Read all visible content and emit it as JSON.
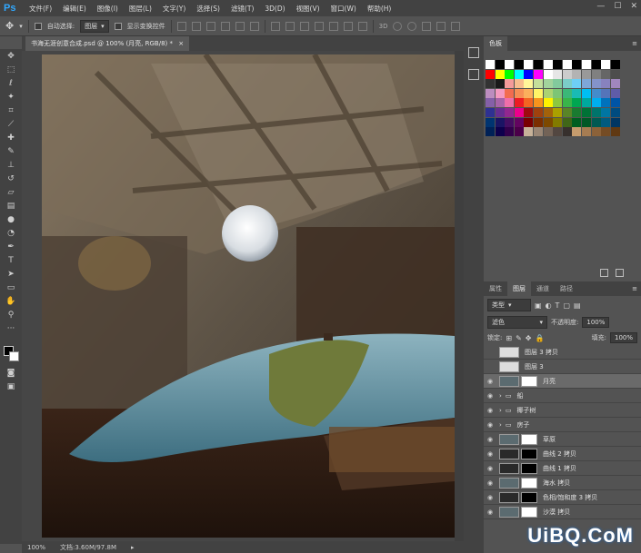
{
  "app": {
    "logo": "Ps"
  },
  "menu": [
    "文件(F)",
    "编辑(E)",
    "图像(I)",
    "图层(L)",
    "文字(Y)",
    "选择(S)",
    "滤镜(T)",
    "3D(D)",
    "视图(V)",
    "窗口(W)",
    "帮助(H)"
  ],
  "options": {
    "auto_select_label": "自动选择:",
    "auto_select_value": "图层",
    "show_transform_label": "显示变换控件"
  },
  "document": {
    "tab_title": "书海无涯创意合成.psd @ 100% (月亮, RGB/8) *"
  },
  "status": {
    "zoom": "100%",
    "doc_size": "文档:3.60M/97.8M"
  },
  "panels": {
    "swatches_tab": "色板",
    "layers_tabs": [
      "属性",
      "图层",
      "通道",
      "路径"
    ],
    "filter_kind": "类型",
    "blend_mode": "滤色",
    "opacity_label": "不透明度:",
    "opacity_value": "100%",
    "lock_label": "锁定:",
    "fill_label": "填充:",
    "fill_value": "100%"
  },
  "layers": [
    {
      "name": "图层 3 拷贝",
      "type": "layer",
      "visible": false
    },
    {
      "name": "图层 3",
      "type": "layer",
      "visible": false
    },
    {
      "name": "月亮",
      "type": "layer-mask",
      "visible": true,
      "selected": true
    },
    {
      "name": "船",
      "type": "group",
      "visible": true
    },
    {
      "name": "椰子树",
      "type": "group",
      "visible": true
    },
    {
      "name": "房子",
      "type": "group",
      "visible": true
    },
    {
      "name": "草原",
      "type": "layer-mask",
      "visible": true
    },
    {
      "name": "曲线 2 拷贝",
      "type": "adjustment",
      "visible": true
    },
    {
      "name": "曲线 1 拷贝",
      "type": "adjustment",
      "visible": true
    },
    {
      "name": "海水 拷贝",
      "type": "layer-mask",
      "visible": true
    },
    {
      "name": "色相/饱和度 3 拷贝",
      "type": "adjustment",
      "visible": true
    },
    {
      "name": "沙漠 拷贝",
      "type": "layer-mask",
      "visible": true
    }
  ],
  "colors": {
    "ps_blue": "#31a8ff",
    "panel": "#535353",
    "dark": "#424242",
    "selected_layer": "#6a6a6a"
  },
  "swatch_colors": [
    "#ffffff",
    "#000000",
    "#ffffff",
    "#000000",
    "#ffffff",
    "#000000",
    "#ffffff",
    "#000000",
    "#ffffff",
    "#000000",
    "#ffffff",
    "#000000",
    "#ffffff",
    "#000000",
    "#ff0000",
    "#ffff00",
    "#00ff00",
    "#00ffff",
    "#0000ff",
    "#ff00ff",
    "#ffffff",
    "#e6e6e6",
    "#cccccc",
    "#b3b3b3",
    "#999999",
    "#808080",
    "#666666",
    "#4d4d4d",
    "#333333",
    "#1a1a1a",
    "#f49a9a",
    "#f7bd8e",
    "#fff799",
    "#c4df9b",
    "#a2d39c",
    "#82ca9d",
    "#7bcdc8",
    "#6ecff6",
    "#7ea7d8",
    "#8493ca",
    "#8882be",
    "#a187be",
    "#bc8dbf",
    "#f49ac1",
    "#f26c4f",
    "#f68e55",
    "#fbaf5c",
    "#fff467",
    "#acd372",
    "#7cc576",
    "#3bb878",
    "#1abbb4",
    "#00bff3",
    "#448ccb",
    "#5574b9",
    "#605ca8",
    "#8560a8",
    "#a864a8",
    "#f06ea9",
    "#ed1c24",
    "#f26522",
    "#f7941d",
    "#fff200",
    "#8dc73f",
    "#39b54a",
    "#00a651",
    "#00a99d",
    "#00aeef",
    "#0072bc",
    "#0054a6",
    "#2e3192",
    "#662d91",
    "#92278f",
    "#ec008c",
    "#9e0b0f",
    "#a0410d",
    "#a3620a",
    "#aba000",
    "#598527",
    "#1a7b30",
    "#007236",
    "#00746b",
    "#0076a3",
    "#004b80",
    "#003471",
    "#1b1464",
    "#440e62",
    "#630460",
    "#790000",
    "#7b2e00",
    "#7d4900",
    "#827b00",
    "#406618",
    "#005e20",
    "#005826",
    "#005952",
    "#005b7f",
    "#003663",
    "#002157",
    "#0d004c",
    "#32004b",
    "#4b0049",
    "#c7b299",
    "#998675",
    "#736357",
    "#534741",
    "#37302d",
    "#c69c6d",
    "#a67c52",
    "#8c6239",
    "#754c24",
    "#603913"
  ]
}
